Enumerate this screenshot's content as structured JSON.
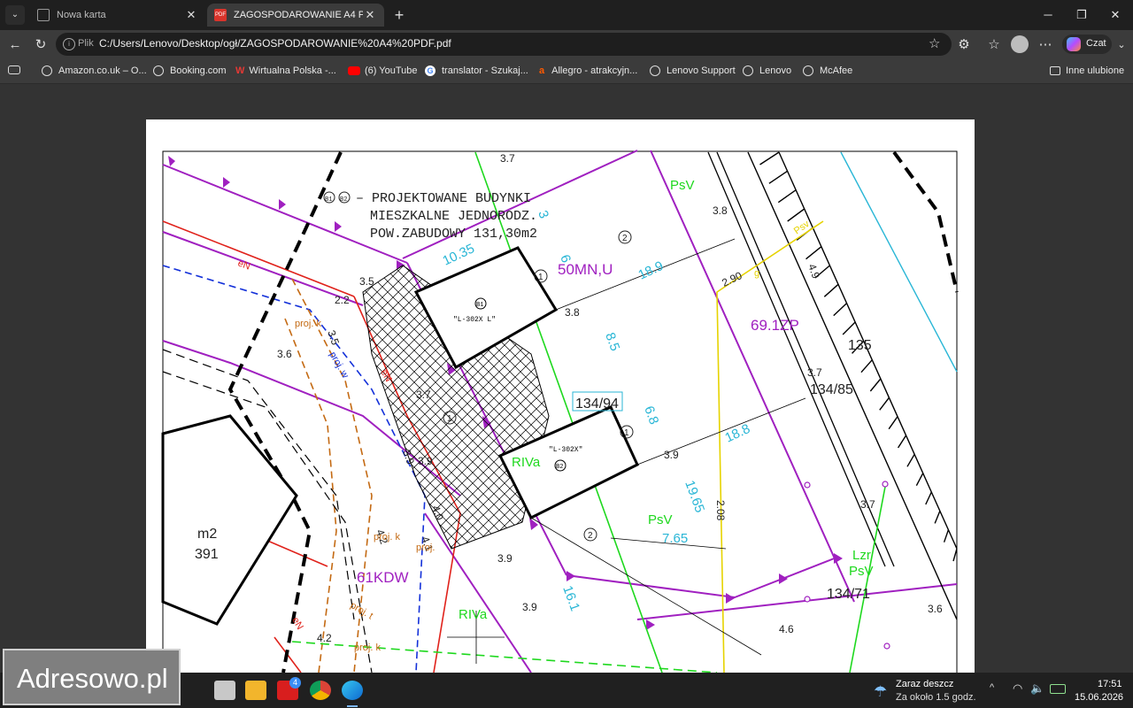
{
  "tabs": [
    {
      "title": "Nowa karta",
      "active": false
    },
    {
      "title": "ZAGOSPODAROWANIE A4 PDF.pdf",
      "active": true
    }
  ],
  "address": {
    "scheme": "Plik",
    "url": "C:/Users/Lenovo/Desktop/ogł/ZAGOSPODAROWANIE%20A4%20PDF.pdf"
  },
  "copilot_label": "Czat",
  "bookmarks": [
    {
      "label": "Amazon.co.uk – O..."
    },
    {
      "label": "Booking.com"
    },
    {
      "label": "Wirtualna Polska -..."
    },
    {
      "label": "(6) YouTube"
    },
    {
      "label": "translator - Szukaj..."
    },
    {
      "label": "Allegro - atrakcyjn..."
    },
    {
      "label": "Lenovo Support"
    },
    {
      "label": "Lenovo"
    },
    {
      "label": "McAfee"
    }
  ],
  "other_favorites": "Inne ulubione",
  "drawing": {
    "legend": [
      "– PROJEKTOWANE BUDYNKI",
      "MIESZKALNE JEDNORODZ.",
      "POW.ZABUDOWY 131,30m2"
    ],
    "legend_markers": [
      "B1",
      "B2"
    ],
    "zones": [
      "50MN,U",
      "69.1ZP",
      "61KDW",
      "PsV",
      "RIVa",
      "Lzr"
    ],
    "building_labels": [
      "\"L-302X L\"",
      "\"L-302X\"",
      "B1",
      "B2"
    ],
    "parcels": [
      "134/94",
      "134/85",
      "135",
      "134/71",
      "m2",
      "391"
    ],
    "dimensions_cyan": [
      "10.35",
      "18.9",
      "8.5",
      "6.8",
      "18.8",
      "19.65",
      "16.1",
      "7.65",
      "3",
      "6"
    ],
    "dimensions_black": [
      "3.7",
      "3.8",
      "3.5",
      "2.2",
      "3.5",
      "3.6",
      "3.7",
      "3.8",
      "3.9",
      "3.9",
      "4.0",
      "4.1",
      "4.2",
      "4.2",
      "3.9",
      "3.9",
      "3.9",
      "2.90",
      "4.9",
      "3.7",
      "2.08",
      "4.6",
      "3.7",
      "3.6"
    ],
    "circle_numbers": [
      "1",
      "2",
      "1",
      "1",
      "2",
      "1"
    ],
    "utility_labels": [
      "proj. k",
      "proj. w",
      "proj. k",
      "proj.",
      "proj. k",
      "proj. t",
      "proj.",
      "eN",
      "eN",
      "eN",
      "g",
      "Psv"
    ]
  },
  "taskbar": {
    "weather_title": "Zaraz deszcz",
    "weather_sub": "Za około 1.5 godz.",
    "time": "17:51",
    "date": "15.06.2026",
    "mail_badge": "4"
  },
  "watermark": "Adresowo.pl",
  "colors": {
    "magenta": "#a020c0",
    "cyan": "#29b6d6",
    "red": "#e0221b",
    "green": "#1ed81e",
    "yellow": "#e6d300"
  }
}
